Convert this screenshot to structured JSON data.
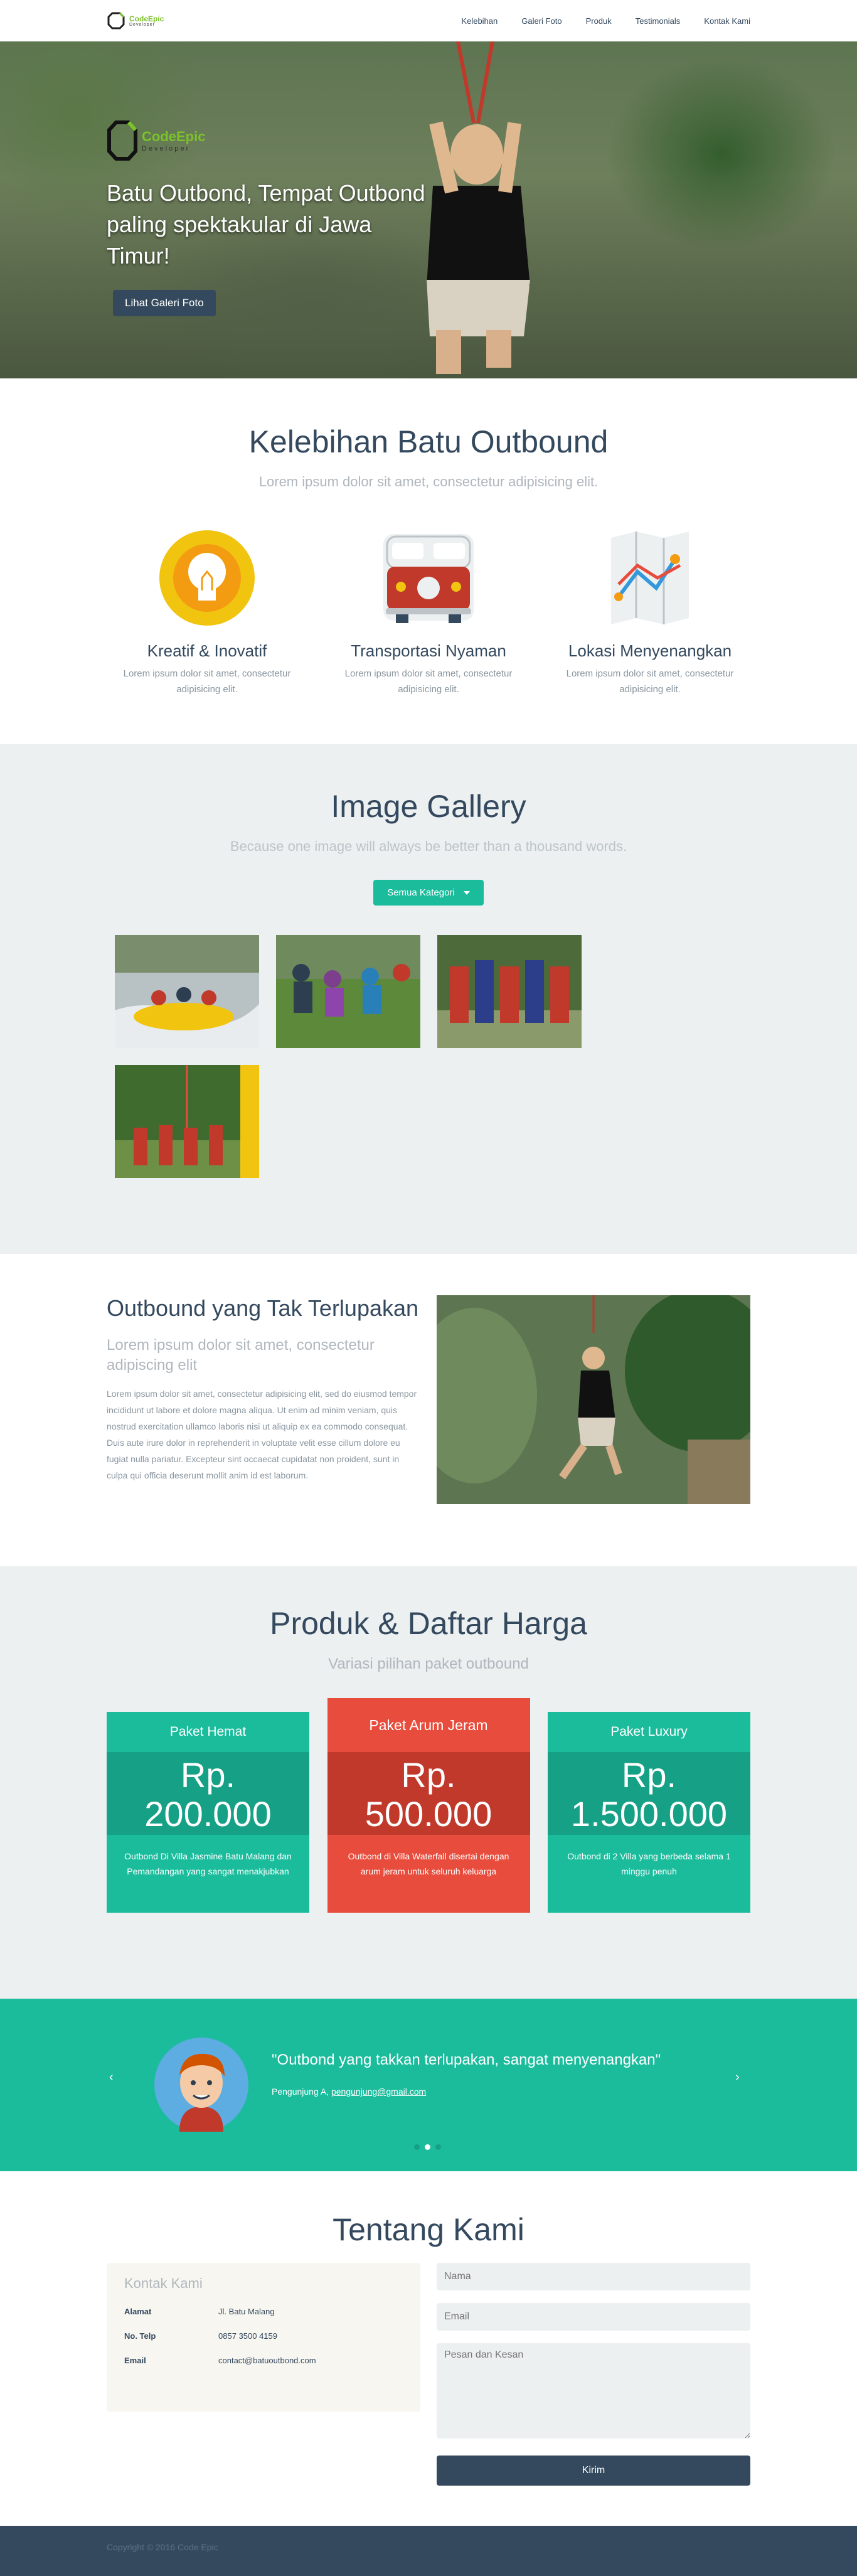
{
  "nav": {
    "brand_main": "Code",
    "brand_accent": "Epic",
    "brand_sub": "Developer",
    "links": [
      "Kelebihan",
      "Galeri Foto",
      "Produk",
      "Testimonials",
      "Kontak Kami"
    ]
  },
  "hero": {
    "logo_main": "Code",
    "logo_accent": "Epic",
    "logo_sub": "Developer",
    "title": "Batu Outbond, Tempat Outbond paling spektakular di Jawa Timur!",
    "button": "Lihat Galeri Foto"
  },
  "features": {
    "title": "Kelebihan Batu Outbound",
    "subtitle": "Lorem ipsum dolor sit amet, consectetur adipisicing elit.",
    "items": [
      {
        "icon": "lightbulb-icon",
        "title": "Kreatif & Inovatif",
        "text": "Lorem ipsum dolor sit amet, consectetur adipisicing elit."
      },
      {
        "icon": "bus-icon",
        "title": "Transportasi Nyaman",
        "text": "Lorem ipsum dolor sit amet, consectetur adipisicing elit."
      },
      {
        "icon": "map-icon",
        "title": "Lokasi Menyenangkan",
        "text": "Lorem ipsum dolor sit amet, consectetur adipisicing elit."
      }
    ]
  },
  "gallery": {
    "title": "Image Gallery",
    "subtitle": "Because one image will always be better than a thousand words.",
    "filter": "Semua Kategori"
  },
  "story": {
    "title": "Outbound yang Tak Terlupakan",
    "subtitle": "Lorem ipsum dolor sit amet, consectetur adipiscing elit",
    "body": "Lorem ipsum dolor sit amet, consectetur adipisicing elit, sed do eiusmod tempor incididunt ut labore et dolore magna aliqua. Ut enim ad minim veniam, quis nostrud exercitation ullamco laboris nisi ut aliquip ex ea commodo consequat. Duis aute irure dolor in reprehenderit in voluptate velit esse cillum dolore eu fugiat nulla pariatur. Excepteur sint occaecat cupidatat non proident, sunt in culpa qui officia deserunt mollit anim id est laborum."
  },
  "products": {
    "title": "Produk & Daftar Harga",
    "subtitle": "Variasi pilihan paket outbound",
    "plans": [
      {
        "name": "Paket Hemat",
        "currency": "Rp.",
        "price": "200.000",
        "desc": "Outbond Di Villa Jasmine Batu Malang dan Pemandangan yang sangat menakjubkan"
      },
      {
        "name": "Paket Arum Jeram",
        "currency": "Rp.",
        "price": "500.000",
        "desc": "Outbond di Villa Waterfall disertai dengan arum jeram untuk seluruh keluarga"
      },
      {
        "name": "Paket Luxury",
        "currency": "Rp.",
        "price": "1.500.000",
        "desc": "Outbond di 2 Villa yang berbeda selama 1 minggu penuh"
      }
    ]
  },
  "testimonial": {
    "quote": "\"Outbond yang takkan terlupakan, sangat menyenangkan\"",
    "author": "Pengunjung A,",
    "email": "pengunjung@gmail.com",
    "prev_icon": "chevron-left-icon",
    "next_icon": "chevron-right-icon"
  },
  "about": {
    "title": "Tentang Kami",
    "box_title": "Kontak Kami",
    "rows": [
      {
        "label": "Alamat",
        "value": "Jl. Batu Malang"
      },
      {
        "label": "No. Telp",
        "value": "0857 3500 4159"
      },
      {
        "label": "Email",
        "value": "contact@batuoutbond.com"
      }
    ],
    "name_placeholder": "Nama",
    "email_placeholder": "Email",
    "message_placeholder": "Pesan dan Kesan",
    "submit": "Kirim"
  },
  "footer": {
    "copyright": "Copyright © 2016 Code Epic"
  }
}
